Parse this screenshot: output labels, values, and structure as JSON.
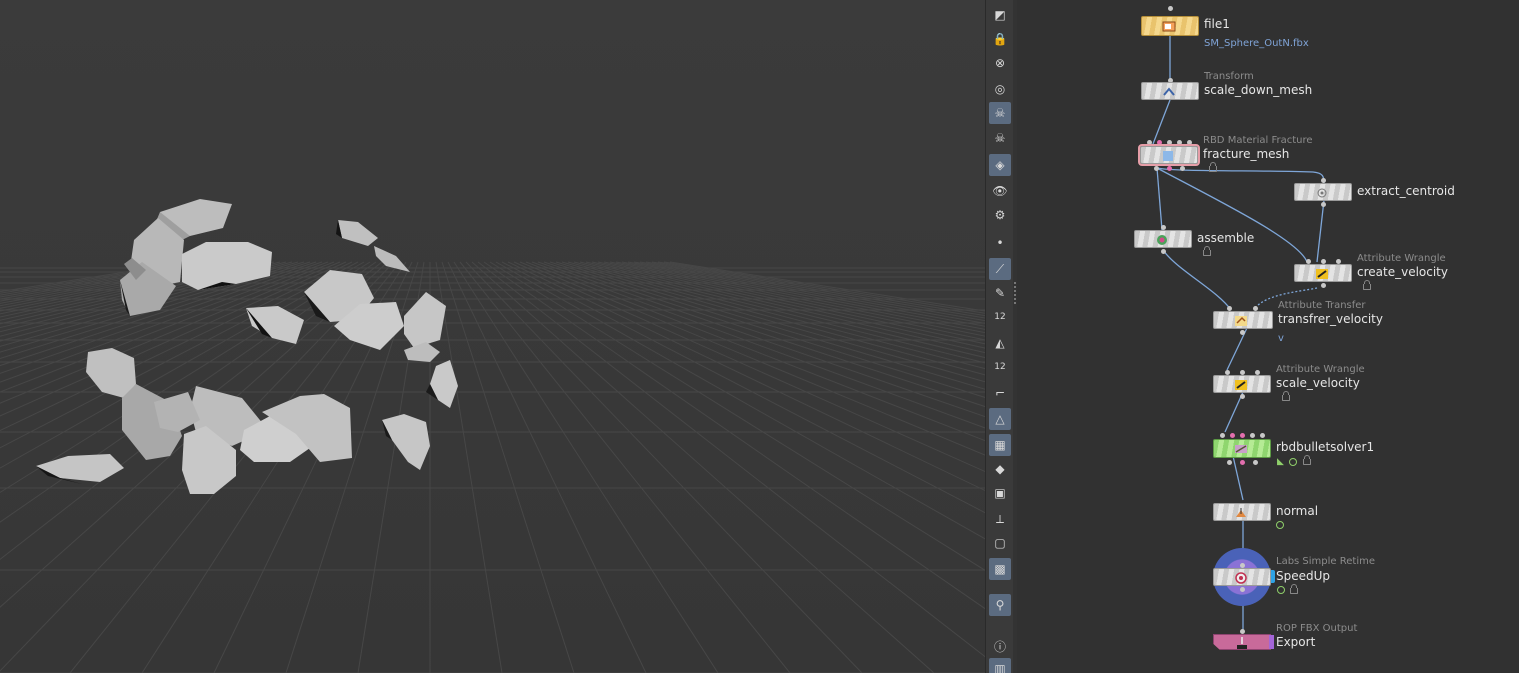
{
  "viewport": {
    "background": "#383838",
    "grid_color": "#4a4a4a",
    "shard_color": "#c4c4c4"
  },
  "toolbar": {
    "items": [
      {
        "name": "select-mode-icon",
        "glyph": "◩",
        "active": false
      },
      {
        "name": "lock-icon",
        "glyph": "🔒",
        "active": false
      },
      {
        "name": "close-icon",
        "glyph": "⊗",
        "active": false
      },
      {
        "name": "ghost-icon",
        "glyph": "◎",
        "active": false
      },
      {
        "name": "skull-icon",
        "glyph": "☠",
        "active": true
      },
      {
        "name": "skull-outline-icon",
        "glyph": "☠",
        "active": false
      },
      {
        "name": "shading-icon",
        "glyph": "◈",
        "active": true
      },
      {
        "name": "eye-icon",
        "glyph": "👁",
        "active": false
      },
      {
        "name": "camera-icon",
        "glyph": "⚙",
        "active": false
      },
      {
        "name": "point-icon",
        "glyph": "•",
        "active": false
      },
      {
        "name": "brush-icon",
        "glyph": "⟋",
        "active": true
      },
      {
        "name": "pen-icon",
        "glyph": "✎",
        "active": false
      },
      {
        "name": "number-points-icon",
        "glyph": "12",
        "active": false
      },
      {
        "name": "primitive-normals-icon",
        "glyph": "◭",
        "active": false
      },
      {
        "name": "number-prims-icon",
        "glyph": "12",
        "active": false
      },
      {
        "name": "corner-icon",
        "glyph": "⌐",
        "active": false
      },
      {
        "name": "wireframe-icon",
        "glyph": "△",
        "active": true
      },
      {
        "name": "checker-icon",
        "glyph": "▦",
        "active": true
      },
      {
        "name": "layers-icon",
        "glyph": "◆",
        "active": false
      },
      {
        "name": "uv-icon",
        "glyph": "▣",
        "active": false
      },
      {
        "name": "axis-icon",
        "glyph": "⟂",
        "active": false
      },
      {
        "name": "frame-icon",
        "glyph": "▢",
        "active": false
      },
      {
        "name": "background-image-icon",
        "glyph": "▩",
        "active": true
      },
      {
        "name": "pin-icon",
        "glyph": "⚲",
        "active": true
      },
      {
        "name": "info-icon",
        "glyph": "ⓘ",
        "active": false
      },
      {
        "name": "layout-icon",
        "glyph": "▥",
        "active": true
      }
    ]
  },
  "network": {
    "nodes": {
      "file1": {
        "type": "",
        "name": "file1",
        "param": "SM_Sphere_OutN.fbx"
      },
      "scale_down_mesh": {
        "type": "Transform",
        "name": "scale_down_mesh"
      },
      "fracture_mesh": {
        "type": "RBD Material Fracture",
        "name": "fracture_mesh"
      },
      "extract_centroid": {
        "type": "",
        "name": "extract_centroid"
      },
      "assemble": {
        "type": "",
        "name": "assemble"
      },
      "create_velocity": {
        "type": "Attribute Wrangle",
        "name": "create_velocity"
      },
      "transfrer_velocity": {
        "type": "Attribute Transfer",
        "name": "transfrer_velocity",
        "param": "v"
      },
      "scale_velocity": {
        "type": "Attribute Wrangle",
        "name": "scale_velocity"
      },
      "rbdbulletsolver1": {
        "type": "",
        "name": "rbdbulletsolver1"
      },
      "normal": {
        "type": "",
        "name": "normal"
      },
      "speedup": {
        "type": "Labs Simple Retime",
        "name": "SpeedUp"
      },
      "export": {
        "type": "ROP FBX Output",
        "name": "Export"
      }
    },
    "colors": {
      "wire": "#7ea6d8",
      "file_node": "#f0cc7a",
      "solver_node": "#a6e184",
      "rop_node": "#c86a9a",
      "hda_ring": "#4a62b8"
    }
  }
}
